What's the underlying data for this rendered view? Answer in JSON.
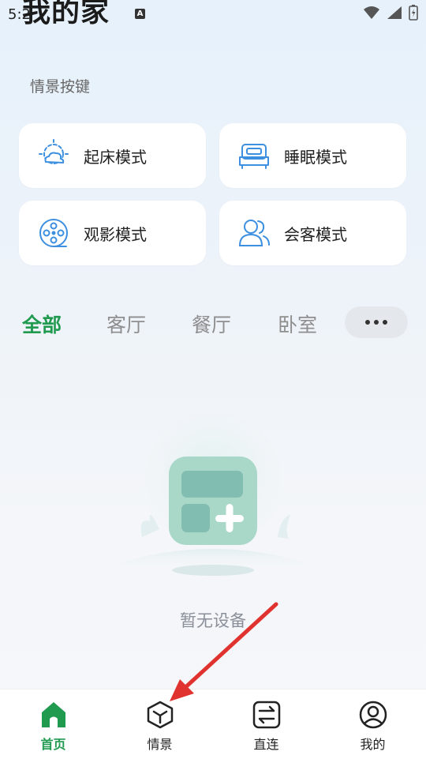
{
  "status": {
    "time": "5:2",
    "badge": "A"
  },
  "header": {
    "title": "我的家"
  },
  "scenes": {
    "section_title": "情景按键",
    "items": [
      {
        "label": "起床模式",
        "icon": "sun-cloud-icon"
      },
      {
        "label": "睡眠模式",
        "icon": "bed-icon"
      },
      {
        "label": "观影模式",
        "icon": "film-reel-icon"
      },
      {
        "label": "会客模式",
        "icon": "people-icon"
      }
    ]
  },
  "rooms": {
    "tabs": [
      "全部",
      "客厅",
      "餐厅",
      "卧室"
    ],
    "active": "全部",
    "more_icon": "more-dots-icon"
  },
  "empty_state": {
    "text": "暂无设备"
  },
  "bottom_nav": {
    "items": [
      {
        "label": "首页",
        "icon": "home-icon"
      },
      {
        "label": "情景",
        "icon": "cube-icon"
      },
      {
        "label": "直连",
        "icon": "swap-arrows-icon"
      },
      {
        "label": "我的",
        "icon": "user-icon"
      }
    ],
    "active": "首页"
  },
  "colors": {
    "accent": "#1f9a4f",
    "icon_blue": "#3d8fe0",
    "annotation_arrow": "#e0332f"
  }
}
